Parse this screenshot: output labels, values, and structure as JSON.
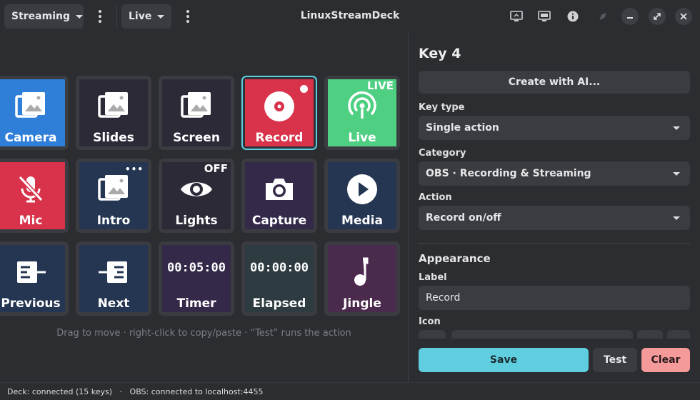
{
  "titlebar": {
    "profile": "Streaming",
    "page": "Live",
    "title": "LinuxStreamDeck"
  },
  "keys": [
    {
      "label": "Camera",
      "icon": "image-icon",
      "color": "#2f7ed8"
    },
    {
      "label": "Slides",
      "icon": "image-icon",
      "color": "#2d2a38"
    },
    {
      "label": "Screen",
      "icon": "image-icon",
      "color": "#2d2a38"
    },
    {
      "label": "Record",
      "icon": "record-disc-icon",
      "color": "#d8334a"
    },
    {
      "label": "Live",
      "icon": "broadcast-icon",
      "color": "#4fcf82",
      "badge": "LIVE"
    },
    {
      "label": "Mic",
      "icon": "mic-off-icon",
      "color": "#d8334a"
    },
    {
      "label": "Intro",
      "icon": "image-icon",
      "color": "#243651"
    },
    {
      "label": "Lights",
      "icon": "eye-icon",
      "color": "#2d2a38",
      "badge": "OFF"
    },
    {
      "label": "Capture",
      "icon": "camera-icon",
      "color": "#35294a"
    },
    {
      "label": "Media",
      "icon": "play-icon",
      "color": "#243651"
    },
    {
      "label": "Previous",
      "icon": "previous-icon",
      "color": "#243651"
    },
    {
      "label": "Next",
      "icon": "next-icon",
      "color": "#243651"
    },
    {
      "label": "Timer",
      "color": "#35294a",
      "value": "00:05:00"
    },
    {
      "label": "Elapsed",
      "color": "#2e3b40",
      "value": "00:00:00"
    },
    {
      "label": "Jingle",
      "icon": "music-note-icon",
      "color": "#4a2b4d"
    }
  ],
  "hint": "Drag to move · right-click to copy/paste · “Test” runs the action",
  "editor": {
    "title": "Key 4",
    "ai_button": "Create with AI...",
    "key_type_label": "Key type",
    "key_type_value": "Single action",
    "category_label": "Category",
    "category_value": "OBS · Recording & Streaming",
    "action_label": "Action",
    "action_value": "Record on/off",
    "appearance_heading": "Appearance",
    "label_label": "Label",
    "label_value": "Record",
    "icon_label": "Icon",
    "save_label": "Save",
    "test_label": "Test",
    "clear_label": "Clear"
  },
  "status": {
    "deck": "Deck: connected (15 keys)",
    "separator": "·",
    "obs": "OBS: connected to localhost:4455"
  },
  "colors": {
    "accent": "#5fcfe0",
    "danger": "#f59a9a",
    "selected_border": "#5fcfe0"
  }
}
